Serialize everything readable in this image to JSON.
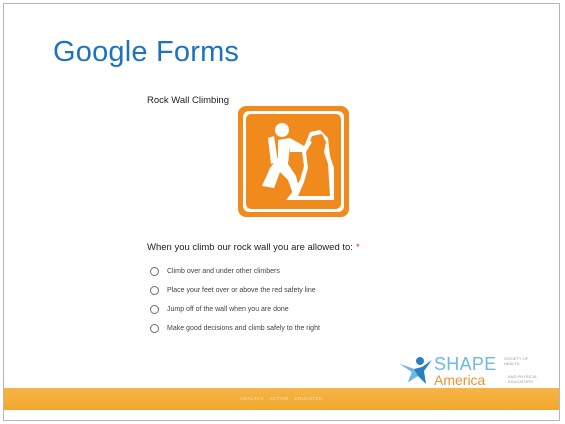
{
  "slide": {
    "title": "Google Forms"
  },
  "form": {
    "title": "Rock Wall Climbing",
    "image_icon": "rock-climber-icon",
    "question": {
      "text": "When you climb our rock wall you are allowed to:",
      "required_mark": "*",
      "options": [
        "Climb over and under other climbers",
        "Place your feet over or above the red safety line",
        "Jump off of the wall when you are done",
        "Make good decisions and climb safely to the right"
      ]
    }
  },
  "logo": {
    "main": "SHAPE",
    "sub": "America",
    "small_top": "SOCIETY OF HEALTH",
    "small_bottom": "AND PHYSICAL EDUCATORS",
    "tagline": "HEALTHY · ACTIVE · EDUCATED"
  },
  "colors": {
    "title": "#1e73be",
    "icon_orange": "#f08a1c",
    "required": "#d93025",
    "band": "#f2a72c"
  }
}
